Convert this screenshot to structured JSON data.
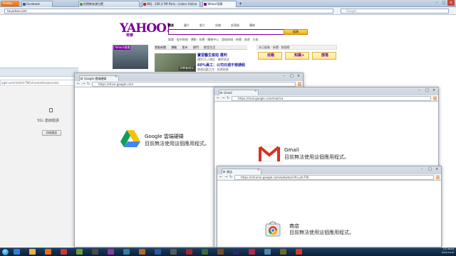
{
  "firefox": {
    "button_label": "Firefox",
    "tabs": [
      {
        "label": "Facebook",
        "color": "#3b5998"
      },
      {
        "label": "阿德勒有源位置",
        "color": "#4ea13d"
      },
      {
        "label": "NRJ - 100.3 FM Paris - Listen Online",
        "color": "#c62828"
      },
      {
        "label": "Yahoo!奇摩",
        "color": "#7b0099"
      }
    ],
    "url": "tw.yahoo.com",
    "search_placeholder": "Google"
  },
  "yahoo": {
    "logo": "YAHOO!",
    "logo_sub": "奇摩",
    "search_tabs": [
      "網頁",
      "圖片",
      "影片",
      "知識",
      "部落格",
      "購物"
    ],
    "search_button": "搜尋",
    "links": "娛樂 · 股市財經 · 運動 · 拍賣 · 購物中心 · 超級商城 · 新聞 · 旅遊 · 天氣",
    "banner_label": "Yahoo!娛樂",
    "hot_tabs": [
      "焦點新聞",
      "運動",
      "股市",
      "熱門",
      "影音生活"
    ],
    "news_caption": "同學會現況",
    "news": [
      {
        "title": "實習醫生偷拍 遭判",
        "sub": "遭判11人確診 · 醫院承認"
      },
      {
        "title": "60%員工：公司日週不想請假",
        "sub": "每週出勤工作 · 投票結果"
      },
      {
        "title": "名人離婚案最新",
        "sub": "法院判決出爐"
      }
    ],
    "right_header": "本日氣象 · 新聞 · 熱搜榜",
    "quick_buttons": [
      "信箱",
      "知識+",
      "部落"
    ]
  },
  "ssl_window": {
    "url": "ogle.com/intl/zh-TW/chrome/browser/we",
    "title": "SSL 連線錯誤",
    "button": "詳細資訊"
  },
  "drive_window": {
    "tab": "Google 雲端硬碟",
    "url": "https://drive.google.com",
    "app_name": "Google 雲端硬碟",
    "message": "目前無法使用這個應用程式。"
  },
  "gmail_window": {
    "tab": "Gmail",
    "url": "https://mail.google.com/mail/ca",
    "app_name": "Gmail",
    "message": "目前無法使用這個應用程式。"
  },
  "store_window": {
    "tab": "商店",
    "url": "https://chrome.google.com/webstore?hl=zh-TW",
    "app_name": "商店",
    "message": "目前無法使用這個應用程式。"
  },
  "taskbar": {
    "icons": [
      {
        "name": "ie-icon",
        "color": "#2f7fd1"
      },
      {
        "name": "explorer-icon",
        "color": "#e7b53a"
      },
      {
        "name": "firefox-icon",
        "color": "#e86b16"
      },
      {
        "name": "media-icon",
        "color": "#c63a3a"
      },
      {
        "name": "app-icon-1",
        "color": "#6a9a3a"
      },
      {
        "name": "app-icon-2",
        "color": "#4a4a4a"
      },
      {
        "name": "app-icon-3",
        "color": "#8a3a9a"
      },
      {
        "name": "app-icon-4",
        "color": "#3a7a9a"
      },
      {
        "name": "app-icon-5",
        "color": "#aa6a2a"
      },
      {
        "name": "app-icon-6",
        "color": "#2a5a9a"
      },
      {
        "name": "app-icon-7",
        "color": "#5a5a5a"
      },
      {
        "name": "app-icon-8",
        "color": "#9a2a2a"
      },
      {
        "name": "app-icon-9",
        "color": "#3a6a3a"
      },
      {
        "name": "app-icon-10",
        "color": "#7a4a2a"
      },
      {
        "name": "app-icon-11",
        "color": "#2a2a6a"
      },
      {
        "name": "app-icon-12",
        "color": "#b02a4a"
      },
      {
        "name": "app-icon-13",
        "color": "#4a8aaa"
      },
      {
        "name": "app-icon-14",
        "color": "#6a6a2a"
      },
      {
        "name": "chrome-icon",
        "color": "#d43a2a"
      }
    ],
    "clock_time": "下午 06:09",
    "clock_date": "2012/11/15"
  }
}
